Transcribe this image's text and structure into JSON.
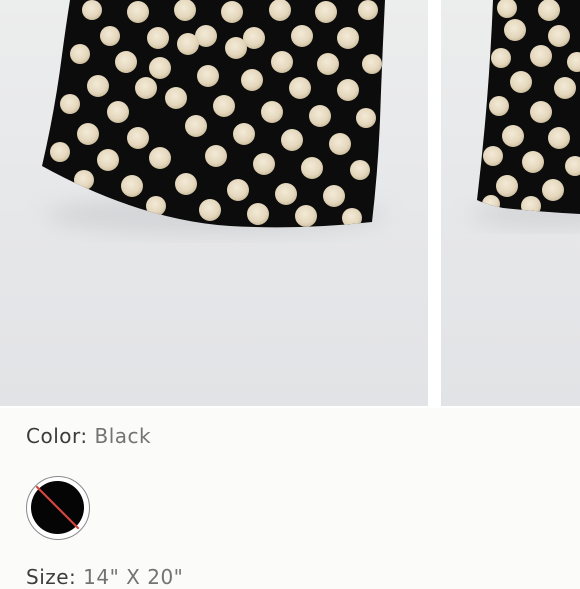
{
  "product": {
    "images": [
      {
        "alt": "Black faux fur pillow with cream polka dots"
      },
      {
        "alt": "Black faux fur pillow with cream polka dots, alternate view"
      }
    ],
    "color_label": "Color:",
    "color_value": "Black",
    "swatches": [
      {
        "name": "Black",
        "hex": "#050505",
        "state": "unavailable"
      }
    ],
    "size_label": "Size:",
    "size_value": "14\" X 20\""
  },
  "colors": {
    "background": "#fbfbfa",
    "photo_background": "#e6e7e9",
    "pillow_fur": "#0b0b0b",
    "dot": "#e8dcc4",
    "swatch_slash": "#d2453f"
  }
}
